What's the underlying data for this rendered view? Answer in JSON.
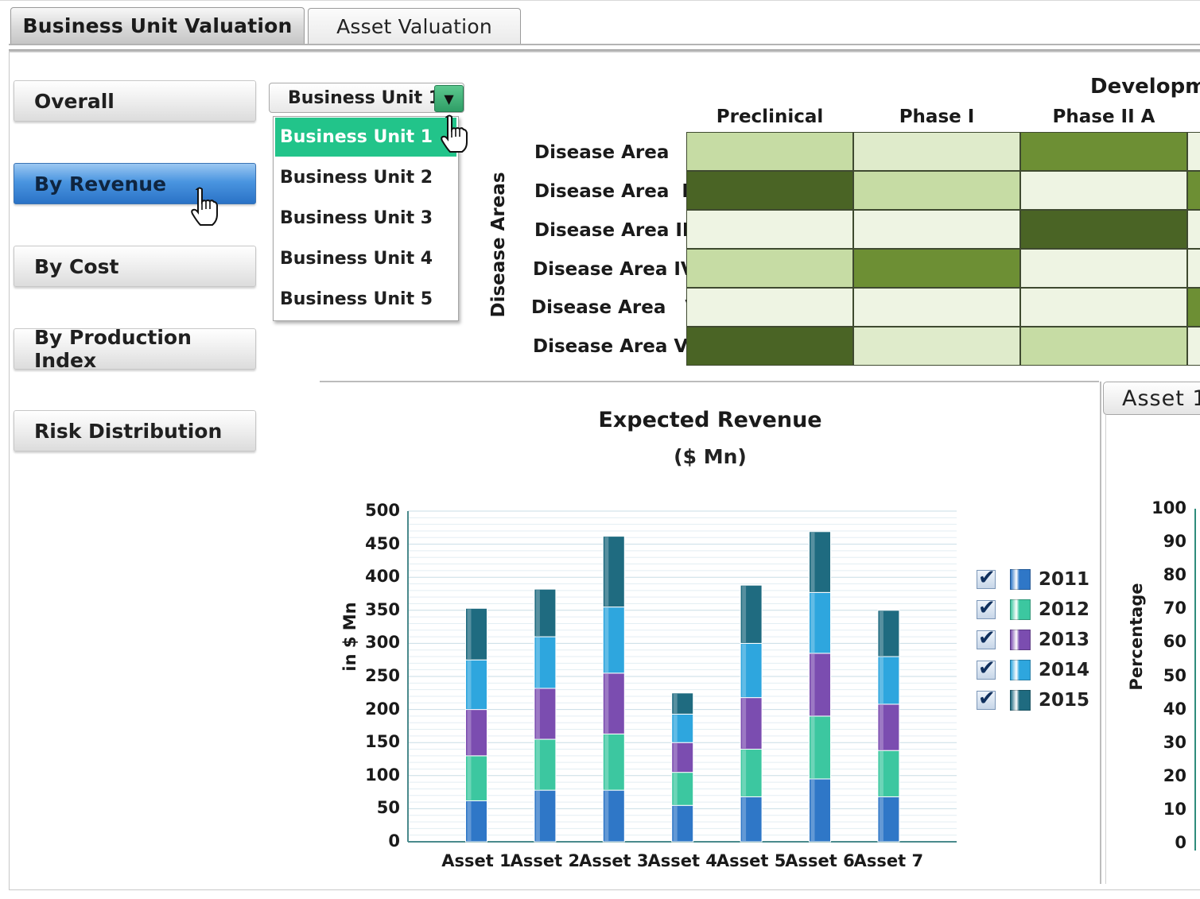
{
  "tabs": [
    {
      "label": "Business Unit Valuation",
      "active": true
    },
    {
      "label": "Asset Valuation",
      "active": false
    }
  ],
  "nav": {
    "items": [
      {
        "label": "Overall",
        "active": false
      },
      {
        "label": "By Revenue",
        "active": true
      },
      {
        "label": "By Cost",
        "active": false
      },
      {
        "label": "By Production Index",
        "active": false
      },
      {
        "label": "Risk Distribution",
        "active": false
      }
    ]
  },
  "business_unit_select": {
    "selected": "Business Unit 1",
    "options": [
      "Business Unit 1",
      "Business Unit 2",
      "Business Unit 3",
      "Business Unit 4",
      "Business Unit 5"
    ]
  },
  "heat_matrix": {
    "title": "Developme",
    "row_axis_label": "Disease Areas",
    "columns": [
      "Preclinical",
      "Phase I",
      "Phase II A"
    ],
    "rows": [
      {
        "label": "Disease Area   I",
        "colors": [
          "#c6dca4",
          "#dfebcb",
          "#6d8f34",
          "#eef4e3"
        ]
      },
      {
        "label": "Disease Area  II",
        "colors": [
          "#4a6425",
          "#c6dca4",
          "#eef4e3",
          "#6d8f34"
        ]
      },
      {
        "label": "Disease Area III",
        "colors": [
          "#eef4e3",
          "#eef4e3",
          "#4a6425",
          "#eef4e3"
        ]
      },
      {
        "label": "Disease Area IV",
        "colors": [
          "#c6dca4",
          "#6d8f34",
          "#eef4e3",
          "#eef4e3"
        ]
      },
      {
        "label": "Disease Area   V",
        "colors": [
          "#eef4e3",
          "#eef4e3",
          "#eef4e3",
          "#6d8f34"
        ]
      },
      {
        "label": "Disease Area VI",
        "colors": [
          "#4a6425",
          "#dfebcb",
          "#c6dca4",
          "#eef4e3"
        ]
      }
    ]
  },
  "right_panel": {
    "tab_label": "Asset 1",
    "ylabel": "Percentage",
    "yticks": [
      "100",
      "90",
      "80",
      "70",
      "60",
      "50",
      "40",
      "30",
      "20",
      "10",
      "0"
    ]
  },
  "chart_data": {
    "type": "bar",
    "stacked": true,
    "title": "Expected Revenue",
    "subtitle": "($ Mn)",
    "ylabel": "in $ Mn",
    "xlabel": "",
    "ylim": [
      0,
      500
    ],
    "yticks": [
      0,
      50,
      100,
      150,
      200,
      250,
      300,
      350,
      400,
      450,
      500
    ],
    "grid": true,
    "legend_position": "right",
    "categories": [
      "Asset 1",
      "Asset 2",
      "Asset 3",
      "Asset 4",
      "Asset 5",
      "Asset 6",
      "Asset 7"
    ],
    "series": [
      {
        "name": "2011",
        "color": "#2f77c7",
        "values": [
          62,
          78,
          78,
          55,
          68,
          95,
          68
        ]
      },
      {
        "name": "2012",
        "color": "#3cc7a0",
        "values": [
          68,
          77,
          85,
          50,
          72,
          95,
          70
        ]
      },
      {
        "name": "2013",
        "color": "#7b4db0",
        "values": [
          70,
          77,
          92,
          45,
          78,
          95,
          70
        ]
      },
      {
        "name": "2014",
        "color": "#2ea6de",
        "values": [
          75,
          78,
          100,
          43,
          82,
          92,
          72
        ]
      },
      {
        "name": "2015",
        "color": "#1f6b80",
        "values": [
          78,
          72,
          107,
          32,
          88,
          92,
          70
        ]
      }
    ]
  }
}
